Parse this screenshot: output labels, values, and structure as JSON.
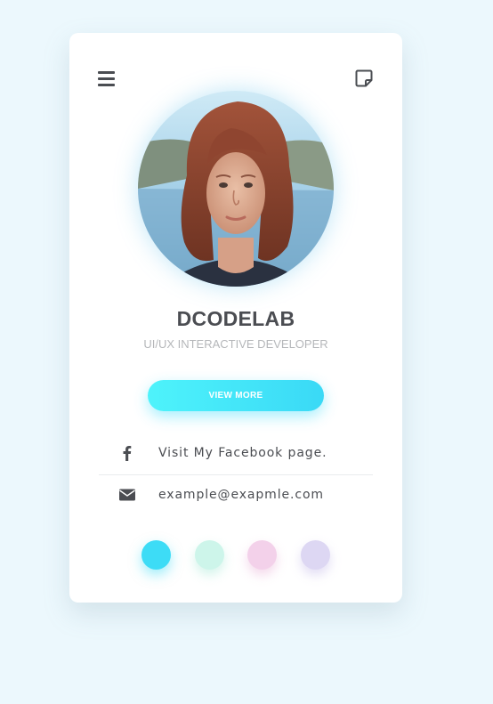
{
  "profile": {
    "name": "DCODELAB",
    "role": "UI/UX INTERACTIVE DEVELOPER",
    "view_more_label": "VIEW MORE"
  },
  "contacts": [
    {
      "icon": "facebook-icon",
      "text": "Visit My Facebook page."
    },
    {
      "icon": "mail-icon",
      "text": "example@exapmle.com"
    }
  ],
  "header": {
    "menu_icon": "hamburger-menu-icon",
    "note_icon": "sticky-note-icon"
  },
  "theme_colors": [
    "#3ddcf6",
    "#cdf5ea",
    "#f3d1ea",
    "#ddd7f3"
  ],
  "colors": {
    "background": "#ecf8fd",
    "card": "#ffffff",
    "accent": "#41e4f8",
    "text_dark": "#4b4d52",
    "text_muted": "#b5b7ba"
  }
}
